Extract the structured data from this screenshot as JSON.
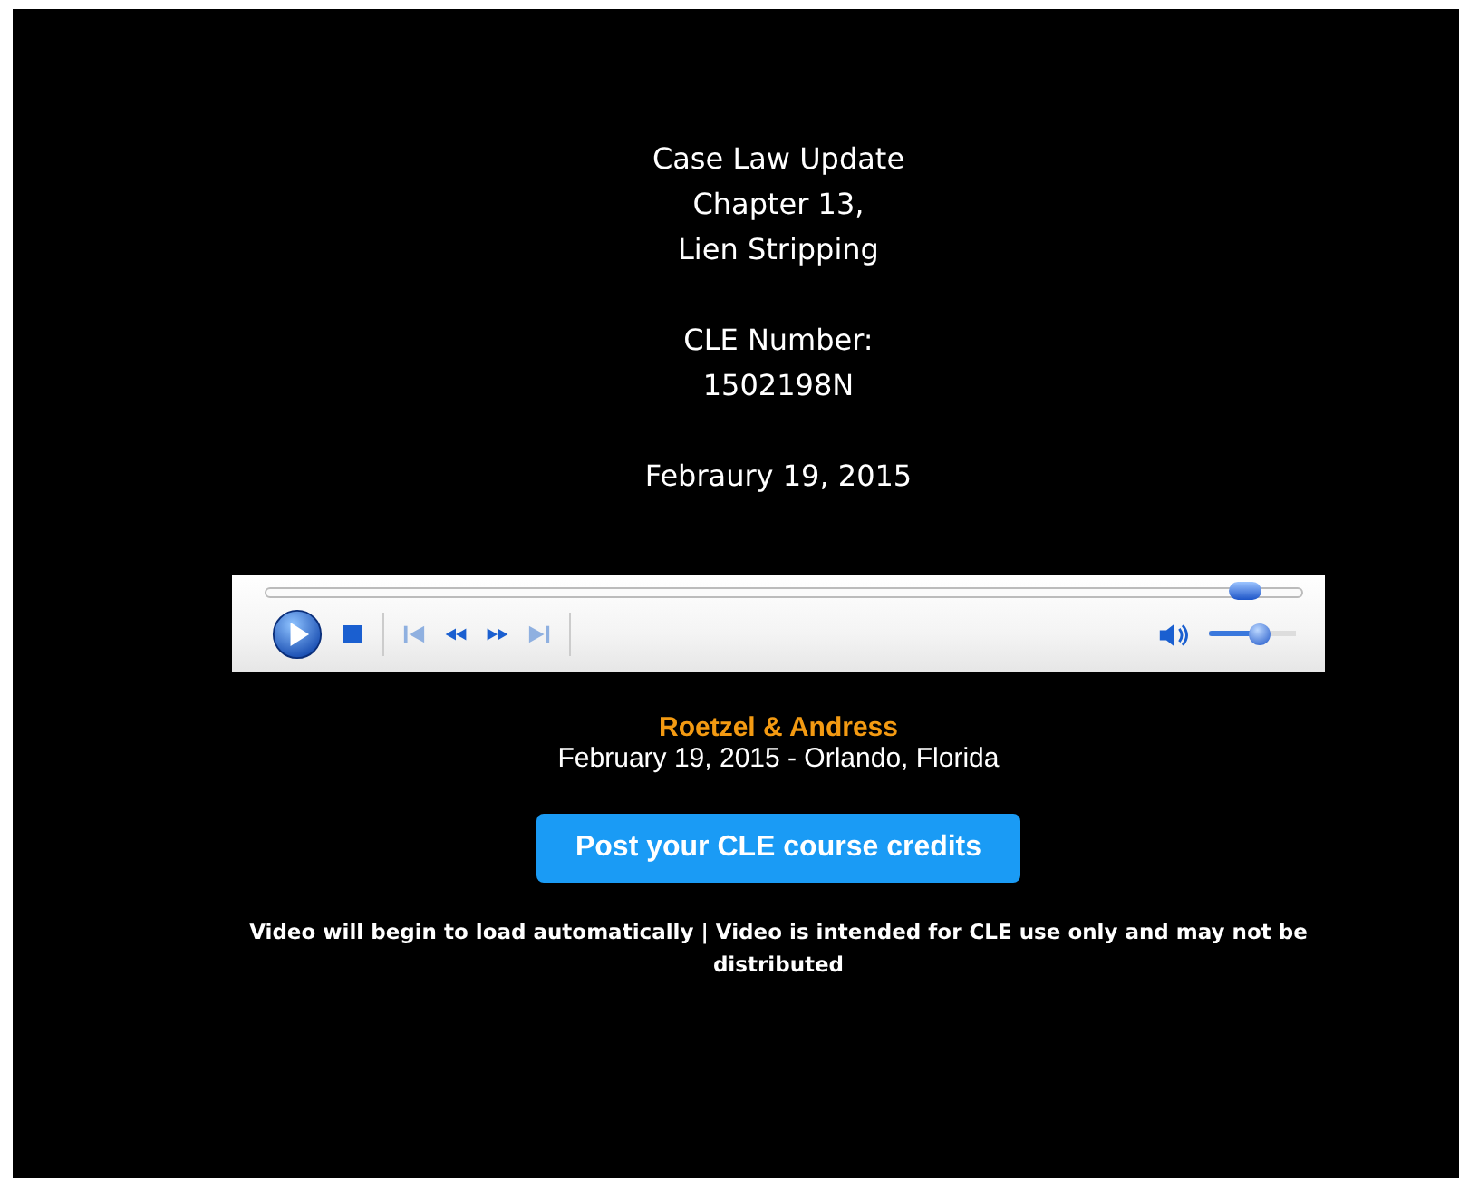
{
  "video": {
    "slide_groups": [
      [
        "Case Law Update",
        "Chapter 13,",
        "Lien Stripping"
      ],
      [
        "CLE Number:",
        "1502198N"
      ],
      [
        "Febraury 19, 2015"
      ]
    ],
    "player": {
      "seek": {
        "level": 0.99
      },
      "volume": {
        "level": 0.6
      }
    }
  },
  "presenter": "Roetzel & Andress",
  "event": "February 19, 2015 - Orlando, Florida",
  "button": "Post your CLE course credits",
  "notice": "Video will begin to load automatically | Video is intended for CLE use only and may not be distributed"
}
